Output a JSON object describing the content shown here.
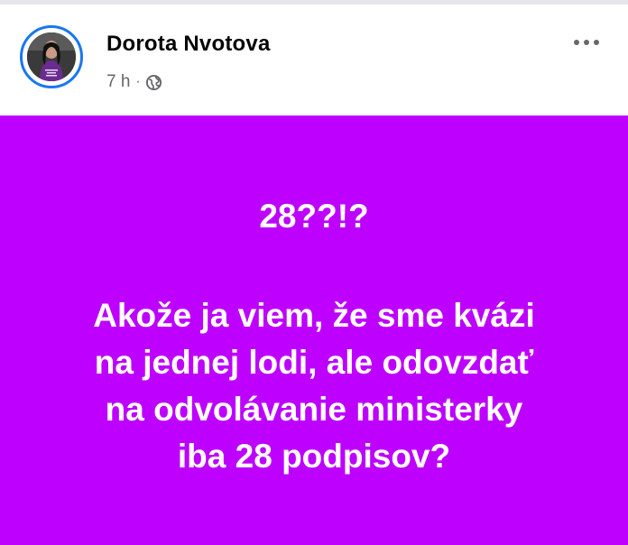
{
  "post": {
    "author_name": "Dorota Nvotova",
    "time": "7 h",
    "separator": "·",
    "audience_icon": "globe-icon",
    "more_icon": "more-horizontal-icon",
    "background_color": "#bd00ff",
    "text_color": "#ffffff",
    "question": "28??!?",
    "body_lines": [
      "Akože ja viem, že sme kvázi",
      "na jednej lodi, ale odovzdať",
      "na odvolávanie ministerky",
      "iba 28 podpisov?"
    ]
  },
  "colors": {
    "avatar_ring": "#1877f2",
    "meta_text": "#65676b",
    "name_text": "#050505"
  }
}
